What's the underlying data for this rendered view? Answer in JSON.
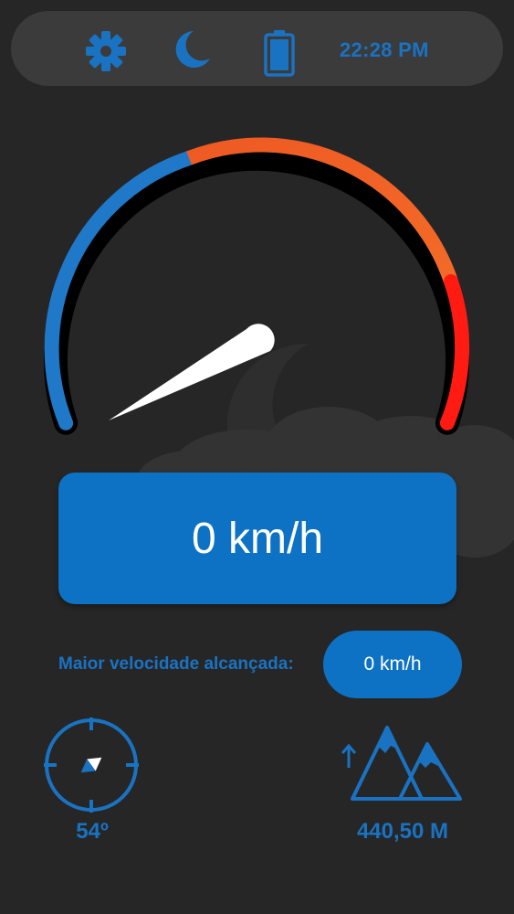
{
  "colors": {
    "background": "#262627",
    "topbar": "#3b3b3c",
    "accent_blue": "#0d72c4",
    "text_blue": "#1a73c2",
    "gauge_cool": "#1f78c8",
    "gauge_warm": "#f05a22",
    "gauge_hot": "#ff1a12",
    "needle": "#ffffff"
  },
  "status_bar": {
    "settings_icon": "gear-icon",
    "night_mode_icon": "moon-icon",
    "battery_icon": "battery-icon",
    "time": "22:28 PM"
  },
  "speedometer": {
    "current_speed_fraction": 0.0,
    "current_speed": "0 km/h"
  },
  "max_speed": {
    "label": "Maior velocidade alcançada:",
    "value": "0 km/h"
  },
  "compass": {
    "icon": "compass-icon",
    "heading": "54º"
  },
  "altitude": {
    "icon": "mountain-altitude-icon",
    "value": "440,50 M"
  }
}
